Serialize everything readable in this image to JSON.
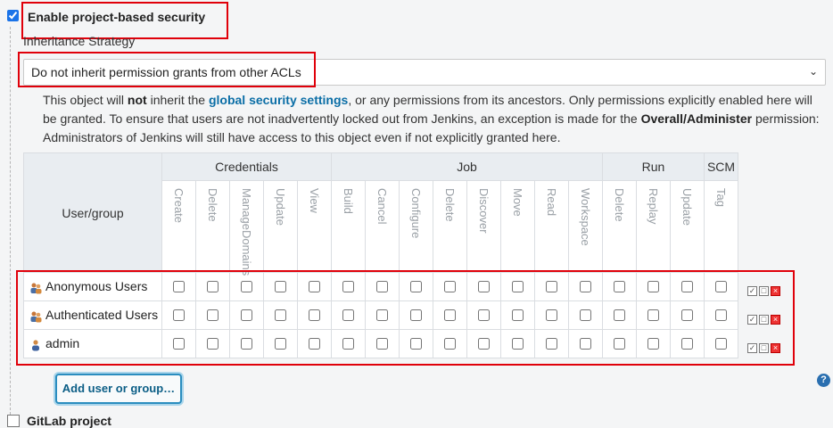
{
  "enable": {
    "label": "Enable project-based security",
    "checked": true
  },
  "inheritance": {
    "label": "Inheritance Strategy",
    "selected": "Do not inherit permission grants from other ACLs",
    "help_pre": "This object will ",
    "help_not": "not",
    "help_mid": " inherit the ",
    "help_link": "global security settings",
    "help_mid2": ", or any permissions from its ancestors. Only permissions explicitly enabled here will be granted. To ensure that users are not inadvertently locked out from Jenkins, an exception is made for the ",
    "help_perm": "Overall/Administer",
    "help_post": " permission: Administrators of Jenkins will still have access to this object even if not explicitly granted here."
  },
  "matrix": {
    "user_group_header": "User/group",
    "groups": [
      {
        "name": "Credentials",
        "permissions": [
          "Create",
          "Delete",
          "ManageDomains",
          "Update",
          "View"
        ]
      },
      {
        "name": "Job",
        "permissions": [
          "Build",
          "Cancel",
          "Configure",
          "Delete",
          "Discover",
          "Move",
          "Read",
          "Workspace"
        ]
      },
      {
        "name": "Run",
        "permissions": [
          "Delete",
          "Replay",
          "Update"
        ]
      },
      {
        "name": "SCM",
        "permissions": [
          "Tag"
        ]
      }
    ],
    "rows": [
      {
        "name": "Anonymous Users",
        "icon": "group-icon"
      },
      {
        "name": "Authenticated Users",
        "icon": "group-icon"
      },
      {
        "name": "admin",
        "icon": "user-icon"
      }
    ]
  },
  "add_button": "Add user or group…",
  "help_icon": "?",
  "next_section": "GitLab project"
}
